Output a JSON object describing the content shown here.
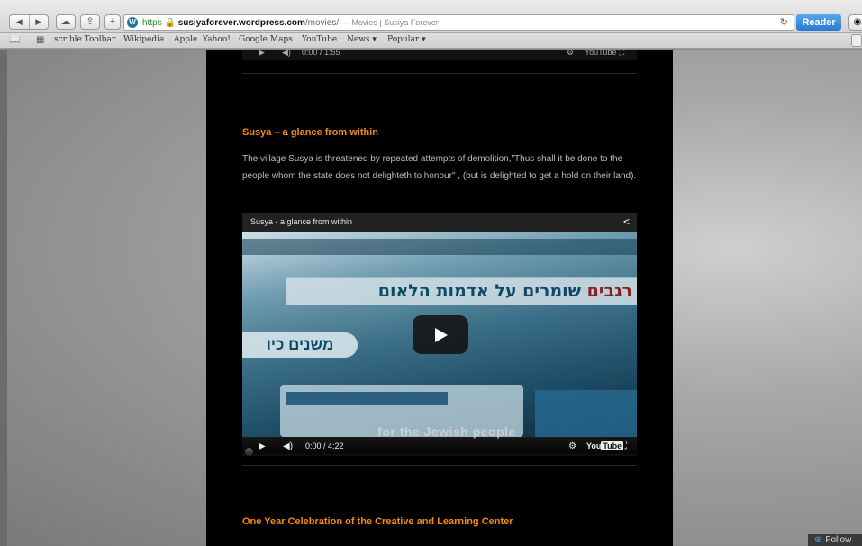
{
  "browser": {
    "url_scheme": "https",
    "url_host": "susiyaforever.wordpress.com",
    "url_path": "/movies/",
    "page_title": "— Movies | Susiya Forever",
    "reader_label": "Reader",
    "nav_back": "◀",
    "nav_forward": "▶",
    "reload_glyph": "↻"
  },
  "bookmarks": [
    "scrible Toolbar",
    "Wikipedia",
    "Apple",
    "Yahoo!",
    "Google Maps",
    "YouTube",
    "News ▾",
    "Popular ▾"
  ],
  "top_player": {
    "time": "0:00 / 1:55"
  },
  "posts": [
    {
      "title": "Susya – a glance from within",
      "body": "The village Susya is threatened by repeated attempts of demolition,\"Thus shall it be done to the people whom the state does not delighteth to honour\" , (but is delighted to get a hold on their land).",
      "video": {
        "title": "Susya - a glance from within",
        "headline_strong": "רגבים",
        "headline_rest": " שומרים על אדמות הלאום",
        "sub_headline": "משנים כיו",
        "caption": "for the Jewish people",
        "time": "0:00 / 4:22",
        "yt_label_a": "You",
        "yt_label_b": "Tube"
      }
    },
    {
      "title": "One Year Celebration of the Creative and Learning Center"
    }
  ],
  "follow": {
    "label": "Follow"
  },
  "colors": {
    "accent_orange": "#f28a14",
    "reader_blue": "#2b79cf",
    "page_black": "#000000"
  }
}
